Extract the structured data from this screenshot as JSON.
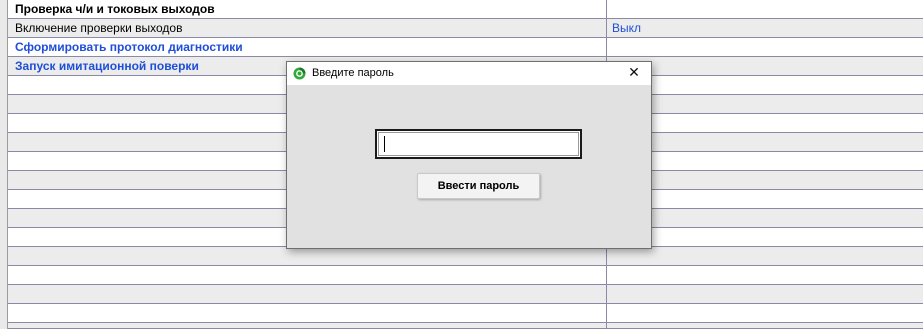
{
  "table": {
    "header_title": "Проверка ч/и и токовых выходов",
    "rows": [
      {
        "name": "Включение проверки выходов",
        "value": "Выкл"
      },
      {
        "name": "Сформировать протокол диагностики",
        "value": ""
      },
      {
        "name": "Запуск имитационной поверки",
        "value": ""
      }
    ]
  },
  "dialog": {
    "title": "Введите пароль",
    "close_symbol": "✕",
    "app_icon": "green-app-icon",
    "password_value": "",
    "submit_label": "Ввести пароль"
  },
  "colors": {
    "link_blue": "#1f4ed8",
    "row_shade": "#ececec",
    "grid_line": "#8a8aa6",
    "dialog_bg": "#e1e1e1"
  }
}
